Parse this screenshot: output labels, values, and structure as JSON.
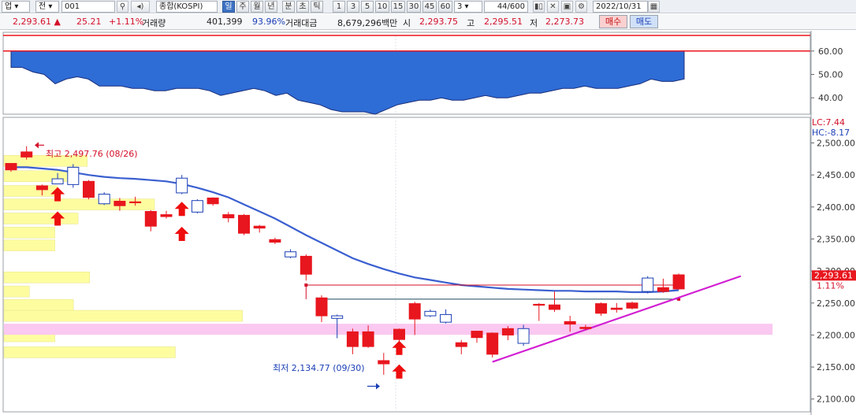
{
  "toolbar": {
    "market": "업",
    "mode": "전",
    "code": "001",
    "name": "종합(KOSPI)",
    "periods": [
      "일",
      "주",
      "월",
      "년",
      "분",
      "초",
      "틱"
    ],
    "active_period": "일",
    "intervals": [
      "1",
      "3",
      "5",
      "10",
      "15",
      "30",
      "45",
      "60"
    ],
    "count_select": "3",
    "range": "44/600",
    "date": "2022/10/31"
  },
  "quote": {
    "price": "2,293.61 ▲",
    "change": "25.21",
    "change_pct": "+1.11%",
    "volume_label": "거래량",
    "volume": "401,399",
    "volume_ratio": "93.96%",
    "amount_label": "거래대금",
    "amount": "8,679,296백만",
    "open_label": "시",
    "open": "2,293.75",
    "high_label": "고",
    "high": "2,295.51",
    "low_label": "저",
    "low": "2,273.73",
    "buy_label": "매수",
    "sell_label": "매도"
  },
  "colors": {
    "up": "#e8161e",
    "down": "#1b3fb5",
    "ma": "#3a5fd0",
    "trend": "#d21fd2",
    "profile": "#fdfda0",
    "profile_pink": "#fac8f0",
    "osc_fill": "#2e6cd6"
  },
  "indicator": {
    "axis_labels": [
      "60.00",
      "50.00",
      "40.00"
    ],
    "ticks": [
      60,
      50,
      40
    ],
    "range": [
      33,
      68
    ],
    "upper_line": 60,
    "values": [
      53,
      53,
      51,
      50,
      46,
      48,
      49,
      48,
      45,
      45,
      45,
      44,
      44,
      43,
      43,
      44,
      44,
      44,
      43,
      41,
      42,
      43,
      44,
      43,
      41,
      42,
      39,
      38,
      37,
      35,
      34,
      34,
      34,
      33,
      35,
      37,
      38,
      39,
      39,
      40,
      39,
      39,
      40,
      41,
      40,
      40,
      41,
      42,
      42,
      43,
      44,
      44,
      45,
      44,
      44,
      44,
      45,
      46,
      48,
      47,
      47,
      48
    ]
  },
  "price_panel": {
    "lc_label": "LC:7.44",
    "hc_label": "HC:-8.17",
    "current_tag": "2,293.61",
    "pct_tag": "1.11%",
    "y_ticks": [
      "2,500.00",
      "2,450.00",
      "2,400.00",
      "2,350.00",
      "2,300.00",
      "2,250.00",
      "2,200.00",
      "2,150.00",
      "2,100.00"
    ],
    "y_tick_values": [
      2500,
      2450,
      2400,
      2350,
      2300,
      2250,
      2200,
      2150,
      2100
    ],
    "range": [
      2080,
      2540
    ],
    "high_annotation": "최고 2,497.76 (08/26)",
    "low_annotation": "최저 2,134.77 (09/30)",
    "candles": [
      {
        "o": 2458,
        "h": 2462,
        "l": 2455,
        "c": 2468
      },
      {
        "o": 2478,
        "h": 2495,
        "l": 2474,
        "c": 2486
      },
      {
        "o": 2427,
        "h": 2435,
        "l": 2418,
        "c": 2433
      },
      {
        "o": 2444,
        "h": 2453,
        "l": 2437,
        "c": 2436
      },
      {
        "o": 2462,
        "h": 2467,
        "l": 2430,
        "c": 2435
      },
      {
        "o": 2415,
        "h": 2442,
        "l": 2412,
        "c": 2440
      },
      {
        "o": 2420,
        "h": 2423,
        "l": 2403,
        "c": 2405
      },
      {
        "o": 2402,
        "h": 2414,
        "l": 2394,
        "c": 2409
      },
      {
        "o": 2408,
        "h": 2416,
        "l": 2402,
        "c": 2408
      },
      {
        "o": 2370,
        "h": 2395,
        "l": 2362,
        "c": 2393
      },
      {
        "o": 2385,
        "h": 2394,
        "l": 2382,
        "c": 2388
      },
      {
        "o": 2445,
        "h": 2450,
        "l": 2420,
        "c": 2422
      },
      {
        "o": 2410,
        "h": 2412,
        "l": 2390,
        "c": 2392
      },
      {
        "o": 2405,
        "h": 2415,
        "l": 2402,
        "c": 2414
      },
      {
        "o": 2383,
        "h": 2392,
        "l": 2376,
        "c": 2388
      },
      {
        "o": 2359,
        "h": 2389,
        "l": 2356,
        "c": 2387
      },
      {
        "o": 2367,
        "h": 2372,
        "l": 2360,
        "c": 2370
      },
      {
        "o": 2345,
        "h": 2352,
        "l": 2342,
        "c": 2349
      },
      {
        "o": 2330,
        "h": 2334,
        "l": 2320,
        "c": 2322
      },
      {
        "o": 2295,
        "h": 2326,
        "l": 2285,
        "c": 2323
      },
      {
        "o": 2230,
        "h": 2262,
        "l": 2220,
        "c": 2258
      },
      {
        "o": 2230,
        "h": 2232,
        "l": 2195,
        "c": 2226
      },
      {
        "o": 2182,
        "h": 2210,
        "l": 2170,
        "c": 2205
      },
      {
        "o": 2182,
        "h": 2215,
        "l": 2180,
        "c": 2205
      },
      {
        "o": 2155,
        "h": 2172,
        "l": 2138,
        "c": 2160
      },
      {
        "o": 2193,
        "h": 2210,
        "l": 2182,
        "c": 2209
      },
      {
        "o": 2225,
        "h": 2252,
        "l": 2200,
        "c": 2249
      },
      {
        "o": 2237,
        "h": 2240,
        "l": 2228,
        "c": 2230
      },
      {
        "o": 2232,
        "h": 2240,
        "l": 2218,
        "c": 2220
      },
      {
        "o": 2182,
        "h": 2192,
        "l": 2170,
        "c": 2188
      },
      {
        "o": 2196,
        "h": 2201,
        "l": 2188,
        "c": 2206
      },
      {
        "o": 2170,
        "h": 2204,
        "l": 2165,
        "c": 2203
      },
      {
        "o": 2200,
        "h": 2214,
        "l": 2192,
        "c": 2210
      },
      {
        "o": 2210,
        "h": 2216,
        "l": 2183,
        "c": 2187
      },
      {
        "o": 2248,
        "h": 2250,
        "l": 2222,
        "c": 2248
      },
      {
        "o": 2240,
        "h": 2268,
        "l": 2236,
        "c": 2247
      },
      {
        "o": 2217,
        "h": 2230,
        "l": 2205,
        "c": 2221
      },
      {
        "o": 2210,
        "h": 2216,
        "l": 2208,
        "c": 2212
      },
      {
        "o": 2234,
        "h": 2251,
        "l": 2230,
        "c": 2249
      },
      {
        "o": 2240,
        "h": 2250,
        "l": 2235,
        "c": 2242
      },
      {
        "o": 2242,
        "h": 2252,
        "l": 2240,
        "c": 2250
      },
      {
        "o": 2289,
        "h": 2292,
        "l": 2265,
        "c": 2268
      },
      {
        "o": 2268,
        "h": 2288,
        "l": 2266,
        "c": 2274
      },
      {
        "o": 2272,
        "h": 2296,
        "l": 2271,
        "c": 2294
      }
    ],
    "ma": [
      2462,
      2462,
      2460,
      2458,
      2454,
      2450,
      2447,
      2445,
      2444,
      2442,
      2440,
      2436,
      2430,
      2423,
      2415,
      2404,
      2393,
      2382,
      2369,
      2356,
      2344,
      2332,
      2320,
      2311,
      2303,
      2296,
      2290,
      2286,
      2282,
      2278,
      2276,
      2274,
      2272,
      2271,
      2270,
      2269,
      2269,
      2268,
      2268,
      2268,
      2267,
      2267,
      2268,
      2270
    ],
    "profile_bars": [
      {
        "price": 2472,
        "len": 0.36
      },
      {
        "price": 2448,
        "len": 0.29
      },
      {
        "price": 2425,
        "len": 0.23
      },
      {
        "price": 2404,
        "len": 0.65
      },
      {
        "price": 2382,
        "len": 0.32
      },
      {
        "price": 2360,
        "len": 0.22
      },
      {
        "price": 2340,
        "len": 0.22
      },
      {
        "price": 2290,
        "len": 0.37
      },
      {
        "price": 2268,
        "len": 0.11
      },
      {
        "price": 2247,
        "len": 0.3
      },
      {
        "price": 2230,
        "len": 1.03
      },
      {
        "price": 2198,
        "len": 0.22
      },
      {
        "price": 2173,
        "len": 0.74
      }
    ],
    "pink_bar": {
      "price": 2209,
      "len": 1.21
    },
    "buy_arrows": [
      {
        "index": 3,
        "price": 2420
      },
      {
        "index": 3,
        "price": 2382
      },
      {
        "index": 11,
        "price": 2397
      },
      {
        "index": 11,
        "price": 2358
      },
      {
        "index": 25,
        "price": 2180
      },
      {
        "index": 25,
        "price": 2143
      }
    ],
    "resistance": {
      "from_index": 19,
      "to_index": 43,
      "price": 2278
    },
    "support": {
      "from_index": 20,
      "to_index": 43,
      "price": 2256
    },
    "trendline": {
      "from_index": 31,
      "from_price": 2158,
      "to_index": 47,
      "to_price": 2292
    }
  }
}
